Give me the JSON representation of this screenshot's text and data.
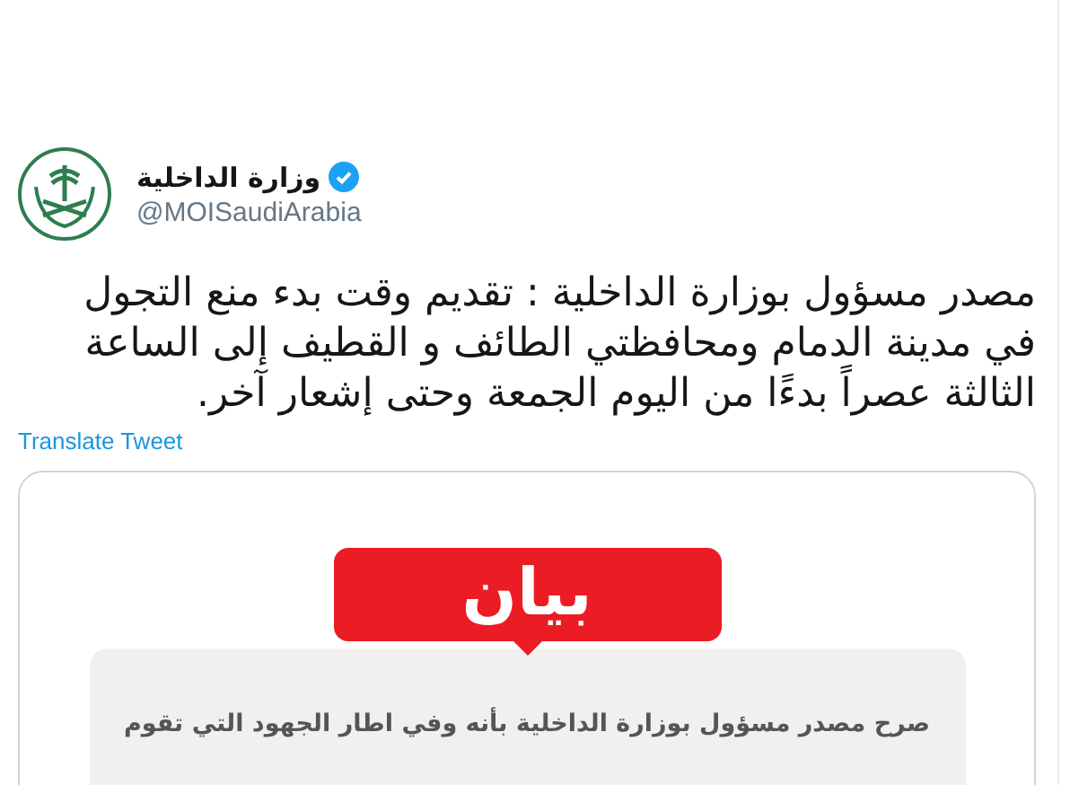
{
  "account": {
    "name": "وزارة الداخلية",
    "verified": true,
    "handle": "@MOISaudiArabia"
  },
  "tweet": {
    "text": "مصدر مسؤول بوزارة الداخلية : تقديم وقت بدء منع التجول في  مدينة الدمام ومحافظتي الطائف و القطيف إلى الساعة الثالثة عصراً بدءًا  من اليوم الجمعة وحتى إشعار آخر.",
    "translate": "Translate Tweet"
  },
  "media": {
    "label": "بيان",
    "body": "صرح مصدر مسؤول بوزارة الداخلية بأنه وفي اطار الجهود التي تقوم"
  }
}
